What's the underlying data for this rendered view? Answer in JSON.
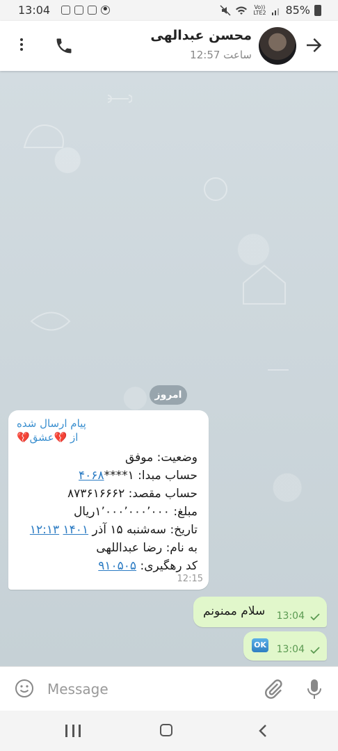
{
  "status_bar": {
    "time": "13:04",
    "network": "Vo)) LTE2",
    "battery": "85%"
  },
  "header": {
    "contact_name": "محسن عبدالهی",
    "last_seen": "ساعت 12:57"
  },
  "chat": {
    "date_chip": "امروز",
    "incoming": {
      "forward_label": "پیام ارسال شده",
      "forward_from_prefix": "از",
      "forward_from_name": "💔عشق💔",
      "lines": {
        "status": "وضعیت: موفق",
        "source_prefix": "حساب مبدا: ۱****",
        "source_link": "۴۰۶۸",
        "dest": "حساب مقصد: ۸۷۳۶۱۶۶۶۲",
        "amount": "مبلغ: ۱٬۰۰۰٬۰۰۰٬۰۰۰ریال",
        "date_prefix": "تاریخ: سه‌شنبه  ۱۵  آذر ",
        "date_year": "۱۴۰۱",
        "date_time": "۱۲:۱۳",
        "name": "به نام: رضا عبداللهی",
        "tracking_prefix": "کد رهگیری: ",
        "tracking_link": "۹۱۰۵۰۵"
      },
      "time": "12:15"
    },
    "outgoing": [
      {
        "text": "سلام ممنونم",
        "time": "13:04"
      },
      {
        "emoji": "OK",
        "time": "13:04"
      }
    ]
  },
  "composer": {
    "placeholder": "Message"
  },
  "icons": {
    "back": "arrow-right-icon",
    "call": "phone-icon",
    "menu": "more-vertical-icon",
    "emoji": "smiley-icon",
    "attach": "paperclip-icon",
    "mic": "microphone-icon"
  },
  "colors": {
    "link": "#2b7bc3",
    "forward_label": "#3a8fcf",
    "outgoing_bubble": "#e1f7cb",
    "outgoing_time": "#5b9a52",
    "chat_background": "#cfd8dc"
  }
}
